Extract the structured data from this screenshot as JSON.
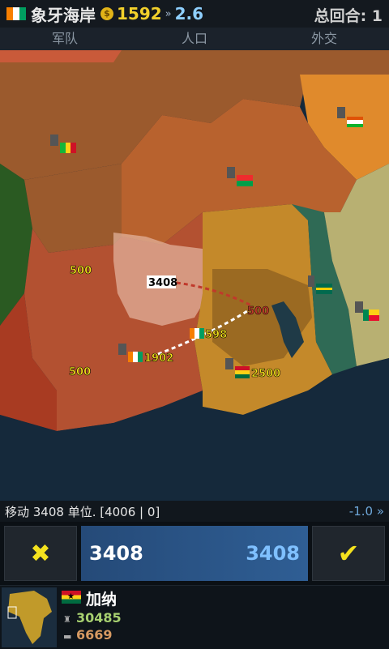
{
  "header": {
    "country": "象牙海岸",
    "gold_icon": "$",
    "gold": "1592",
    "rate_icon": "»",
    "rate": "2.6",
    "turn_label": "总回合: 1"
  },
  "tabs": [
    {
      "label": "军队"
    },
    {
      "label": "人口"
    },
    {
      "label": "外交"
    }
  ],
  "map": {
    "labels": {
      "a": "500",
      "b": "3408",
      "c": "500",
      "d": "598",
      "e": "1902",
      "f": "500",
      "g": "2500"
    }
  },
  "move_info": {
    "text": "移动 3408 单位. [4006 | 0]",
    "value": "-1.0 »"
  },
  "controls": {
    "cancel_icon": "✖",
    "confirm_icon": "✔",
    "amount_left": "3408",
    "amount_right": "3408"
  },
  "selected": {
    "name": "加纳",
    "stat_icon_1": "♜",
    "stat_1": "30485",
    "stat_icon_2": "▬",
    "stat_2": "6669"
  },
  "colors": {
    "ivory_coast": "#c0643a",
    "ghana": "#c4892a",
    "burkina": "#b8622e",
    "mali": "#9b5a2d",
    "niger": "#e08a2c",
    "togo": "#2f6a55",
    "benin": "#b8b072",
    "liberia": "#a83b22",
    "guinea": "#2a5a22",
    "ocean": "#15293b"
  }
}
